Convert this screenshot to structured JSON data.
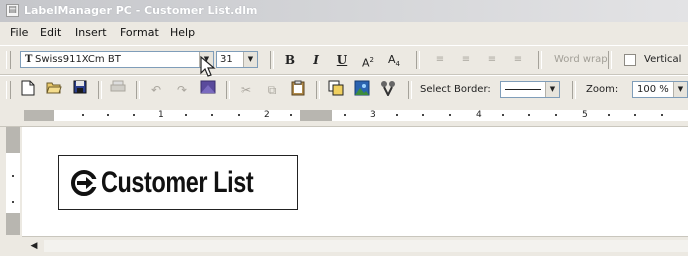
{
  "window": {
    "title": "LabelManager PC - Customer List.dlm"
  },
  "menu": [
    {
      "name": "menu-file",
      "label": "File"
    },
    {
      "name": "menu-edit",
      "label": "Edit"
    },
    {
      "name": "menu-insert",
      "label": "Insert"
    },
    {
      "name": "menu-format",
      "label": "Format"
    },
    {
      "name": "menu-help",
      "label": "Help"
    }
  ],
  "format_toolbar": {
    "font_name": "Swiss911XCm BT",
    "font_size": "31",
    "bold": "B",
    "italic": "I",
    "underline": "U",
    "superscript": "A",
    "subscript": "A",
    "word_wrap_label": "Word wrap",
    "vertical_label": "Vertical"
  },
  "standard_toolbar": {
    "select_border_label": "Select Border:",
    "zoom_label": "Zoom:",
    "zoom_value": "100 %"
  },
  "ruler": {
    "numbers": [
      "1",
      "2",
      "3",
      "4",
      "5"
    ]
  },
  "label": {
    "text": "Customer List"
  },
  "icons": {
    "app": "label-printer-icon",
    "logo": "curved-arrow-logo"
  }
}
